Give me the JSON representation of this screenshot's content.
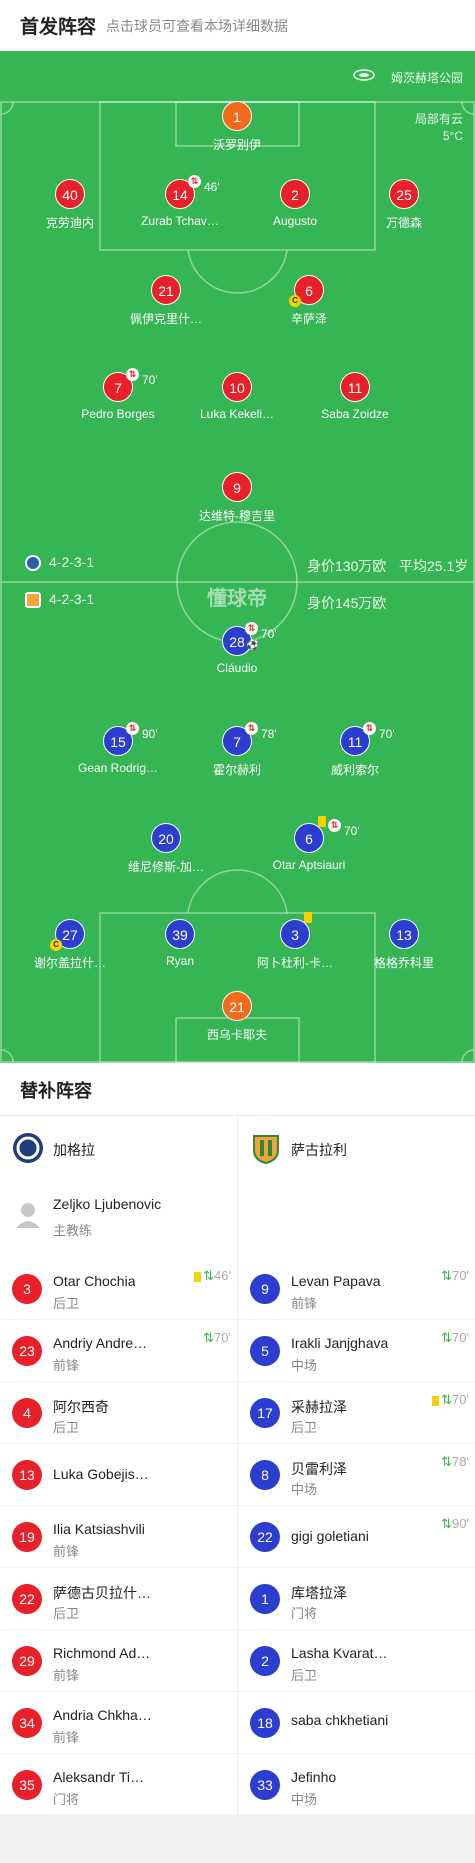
{
  "header": {
    "title": "首发阵容",
    "subtitle": "点击球员可查看本场详细数据"
  },
  "venue": {
    "name": "姆茨赫塔公园",
    "weather": "局部有云",
    "temp": "5°C"
  },
  "watermark": "懂球帝",
  "home": {
    "formation": "4-2-3-1",
    "value": "身价130万欧",
    "avg_age": "平均25.1岁",
    "players": [
      {
        "num": "1",
        "name": "沃罗别伊",
        "color": "orange"
      },
      {
        "num": "40",
        "name": "克劳迪内",
        "color": "red"
      },
      {
        "num": "14",
        "name": "Zurab Tchav…",
        "color": "red",
        "sub": "46'"
      },
      {
        "num": "2",
        "name": "Augusto",
        "color": "red"
      },
      {
        "num": "25",
        "name": "万德森",
        "color": "red"
      },
      {
        "num": "21",
        "name": "佩伊克里什…",
        "color": "red"
      },
      {
        "num": "6",
        "name": "辛萨泽",
        "color": "red",
        "captain": "C"
      },
      {
        "num": "7",
        "name": "Pedro Borges",
        "color": "red",
        "sub": "70'"
      },
      {
        "num": "10",
        "name": "Luka Kekeli…",
        "color": "red"
      },
      {
        "num": "11",
        "name": "Saba Zoidze",
        "color": "red"
      },
      {
        "num": "9",
        "name": "达维特-穆吉里",
        "color": "red"
      }
    ]
  },
  "away": {
    "formation": "4-2-3-1",
    "value": "身价145万欧",
    "players": [
      {
        "num": "28",
        "name": "Cláudio",
        "color": "blue",
        "sub": "70'",
        "goal": "⚽"
      },
      {
        "num": "15",
        "name": "Gean Rodrig…",
        "color": "blue",
        "sub": "90'"
      },
      {
        "num": "7",
        "name": "霍尔赫利",
        "color": "blue",
        "sub": "78'"
      },
      {
        "num": "11",
        "name": "威利索尔",
        "color": "blue",
        "sub": "70'"
      },
      {
        "num": "20",
        "name": "维尼修斯-加…",
        "color": "blue"
      },
      {
        "num": "6",
        "name": "Otar Aptsiauri",
        "color": "blue",
        "sub": "70'",
        "yellow": true
      },
      {
        "num": "27",
        "name": "谢尔盖拉什…",
        "color": "blue",
        "captain": "C"
      },
      {
        "num": "39",
        "name": "Ryan",
        "color": "blue"
      },
      {
        "num": "3",
        "name": "阿卜杜利-卡…",
        "color": "blue",
        "yellow": true
      },
      {
        "num": "13",
        "name": "格格乔科里",
        "color": "blue"
      },
      {
        "num": "21",
        "name": "西乌卡耶夫",
        "color": "orange"
      }
    ]
  },
  "subs": {
    "title": "替补阵容",
    "home_team": "加格拉",
    "away_team": "萨古拉利",
    "coach": {
      "name": "Zeljko Ljubenovic",
      "role": "主教练"
    },
    "home": [
      {
        "num": "3",
        "name": "Otar Chochia",
        "pos": "后卫",
        "event": "46'",
        "yellow": true
      },
      {
        "num": "23",
        "name": "Andriy Andre…",
        "pos": "前锋",
        "event": "70'"
      },
      {
        "num": "4",
        "name": "阿尔西奇",
        "pos": "后卫"
      },
      {
        "num": "13",
        "name": "Luka Gobejis…",
        "pos": ""
      },
      {
        "num": "19",
        "name": "Ilia Katsiashvili",
        "pos": "前锋"
      },
      {
        "num": "22",
        "name": "萨德古贝拉什…",
        "pos": "后卫"
      },
      {
        "num": "29",
        "name": "Richmond Ad…",
        "pos": "前锋"
      },
      {
        "num": "34",
        "name": "Andria Chkha…",
        "pos": "前锋"
      },
      {
        "num": "35",
        "name": "Aleksandr Ti…",
        "pos": "门将"
      }
    ],
    "away": [
      {
        "num": "9",
        "name": "Levan Papava",
        "pos": "前锋",
        "event": "70'"
      },
      {
        "num": "5",
        "name": "Irakli Janjghava",
        "pos": "中场",
        "event": "70'"
      },
      {
        "num": "17",
        "name": "采赫拉泽",
        "pos": "后卫",
        "event": "70'",
        "yellow": true
      },
      {
        "num": "8",
        "name": "贝雷利泽",
        "pos": "中场",
        "event": "78'"
      },
      {
        "num": "22",
        "name": "gigi goletiani",
        "pos": "",
        "event": "90'"
      },
      {
        "num": "1",
        "name": "库塔拉泽",
        "pos": "门将"
      },
      {
        "num": "2",
        "name": "Lasha Kvarat…",
        "pos": "后卫"
      },
      {
        "num": "18",
        "name": "saba chkhetiani",
        "pos": ""
      },
      {
        "num": "33",
        "name": "Jefinho",
        "pos": "中场"
      }
    ]
  },
  "colors": {
    "pitch": "#35b553",
    "home": "#e8202a",
    "away": "#2b3ecf",
    "keeper": "#f26b1d"
  }
}
